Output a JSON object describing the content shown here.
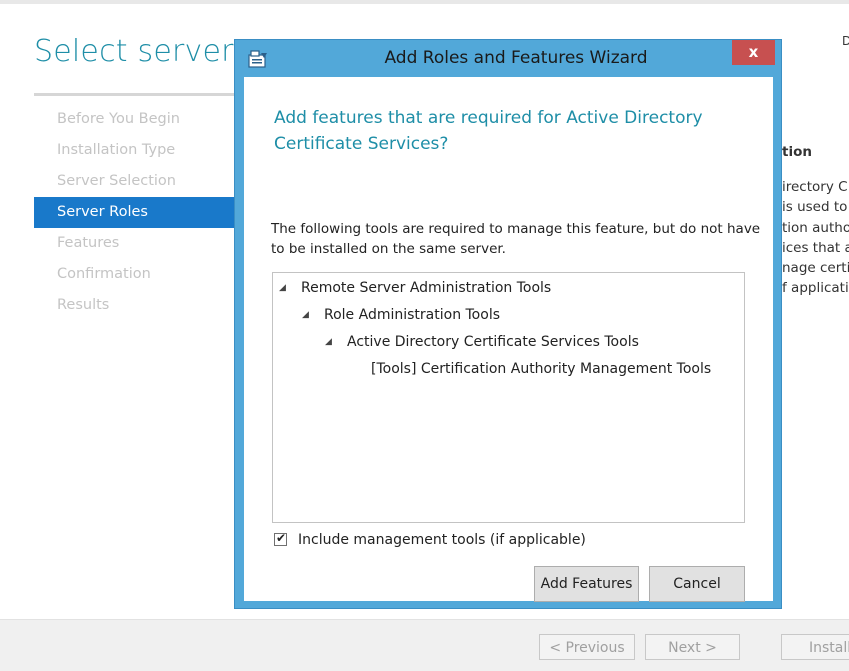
{
  "page": {
    "title": "Select server ro",
    "destination_label": "D",
    "nav_items": [
      {
        "label": "Before You Begin",
        "active": false
      },
      {
        "label": "Installation Type",
        "active": false
      },
      {
        "label": "Server Selection",
        "active": false
      },
      {
        "label": "Server Roles",
        "active": true
      },
      {
        "label": "Features",
        "active": false
      },
      {
        "label": "Confirmation",
        "active": false
      },
      {
        "label": "Results",
        "active": false
      }
    ],
    "description": {
      "heading": "tion",
      "lines": [
        "irectory C",
        "is used to",
        "tion autho",
        "ices that a",
        "nage certif",
        "f applicati"
      ]
    },
    "footer": {
      "previous": "< Previous",
      "next": "Next >",
      "install": "Install"
    }
  },
  "dialog": {
    "title": "Add Roles and Features Wizard",
    "close": "x",
    "heading": "Add features that are required for Active Directory Certificate Services?",
    "description": "The following tools are required to manage this feature, but do not have to be installed on the same server.",
    "tree": [
      {
        "label": "Remote Server Administration Tools",
        "expanded": true
      },
      {
        "label": "Role Administration Tools",
        "expanded": true
      },
      {
        "label": "Active Directory Certificate Services Tools",
        "expanded": true
      },
      {
        "label": "[Tools] Certification Authority Management Tools",
        "expanded": false
      }
    ],
    "include_tools": {
      "label": "Include management tools (if applicable)",
      "checked": true
    },
    "add_button": "Add Features",
    "cancel_button": "Cancel"
  },
  "colors": {
    "accent": "#1e8ea7",
    "selection": "#1979ca",
    "dialog_frame": "#52a8d9",
    "close_button": "#c75050"
  }
}
